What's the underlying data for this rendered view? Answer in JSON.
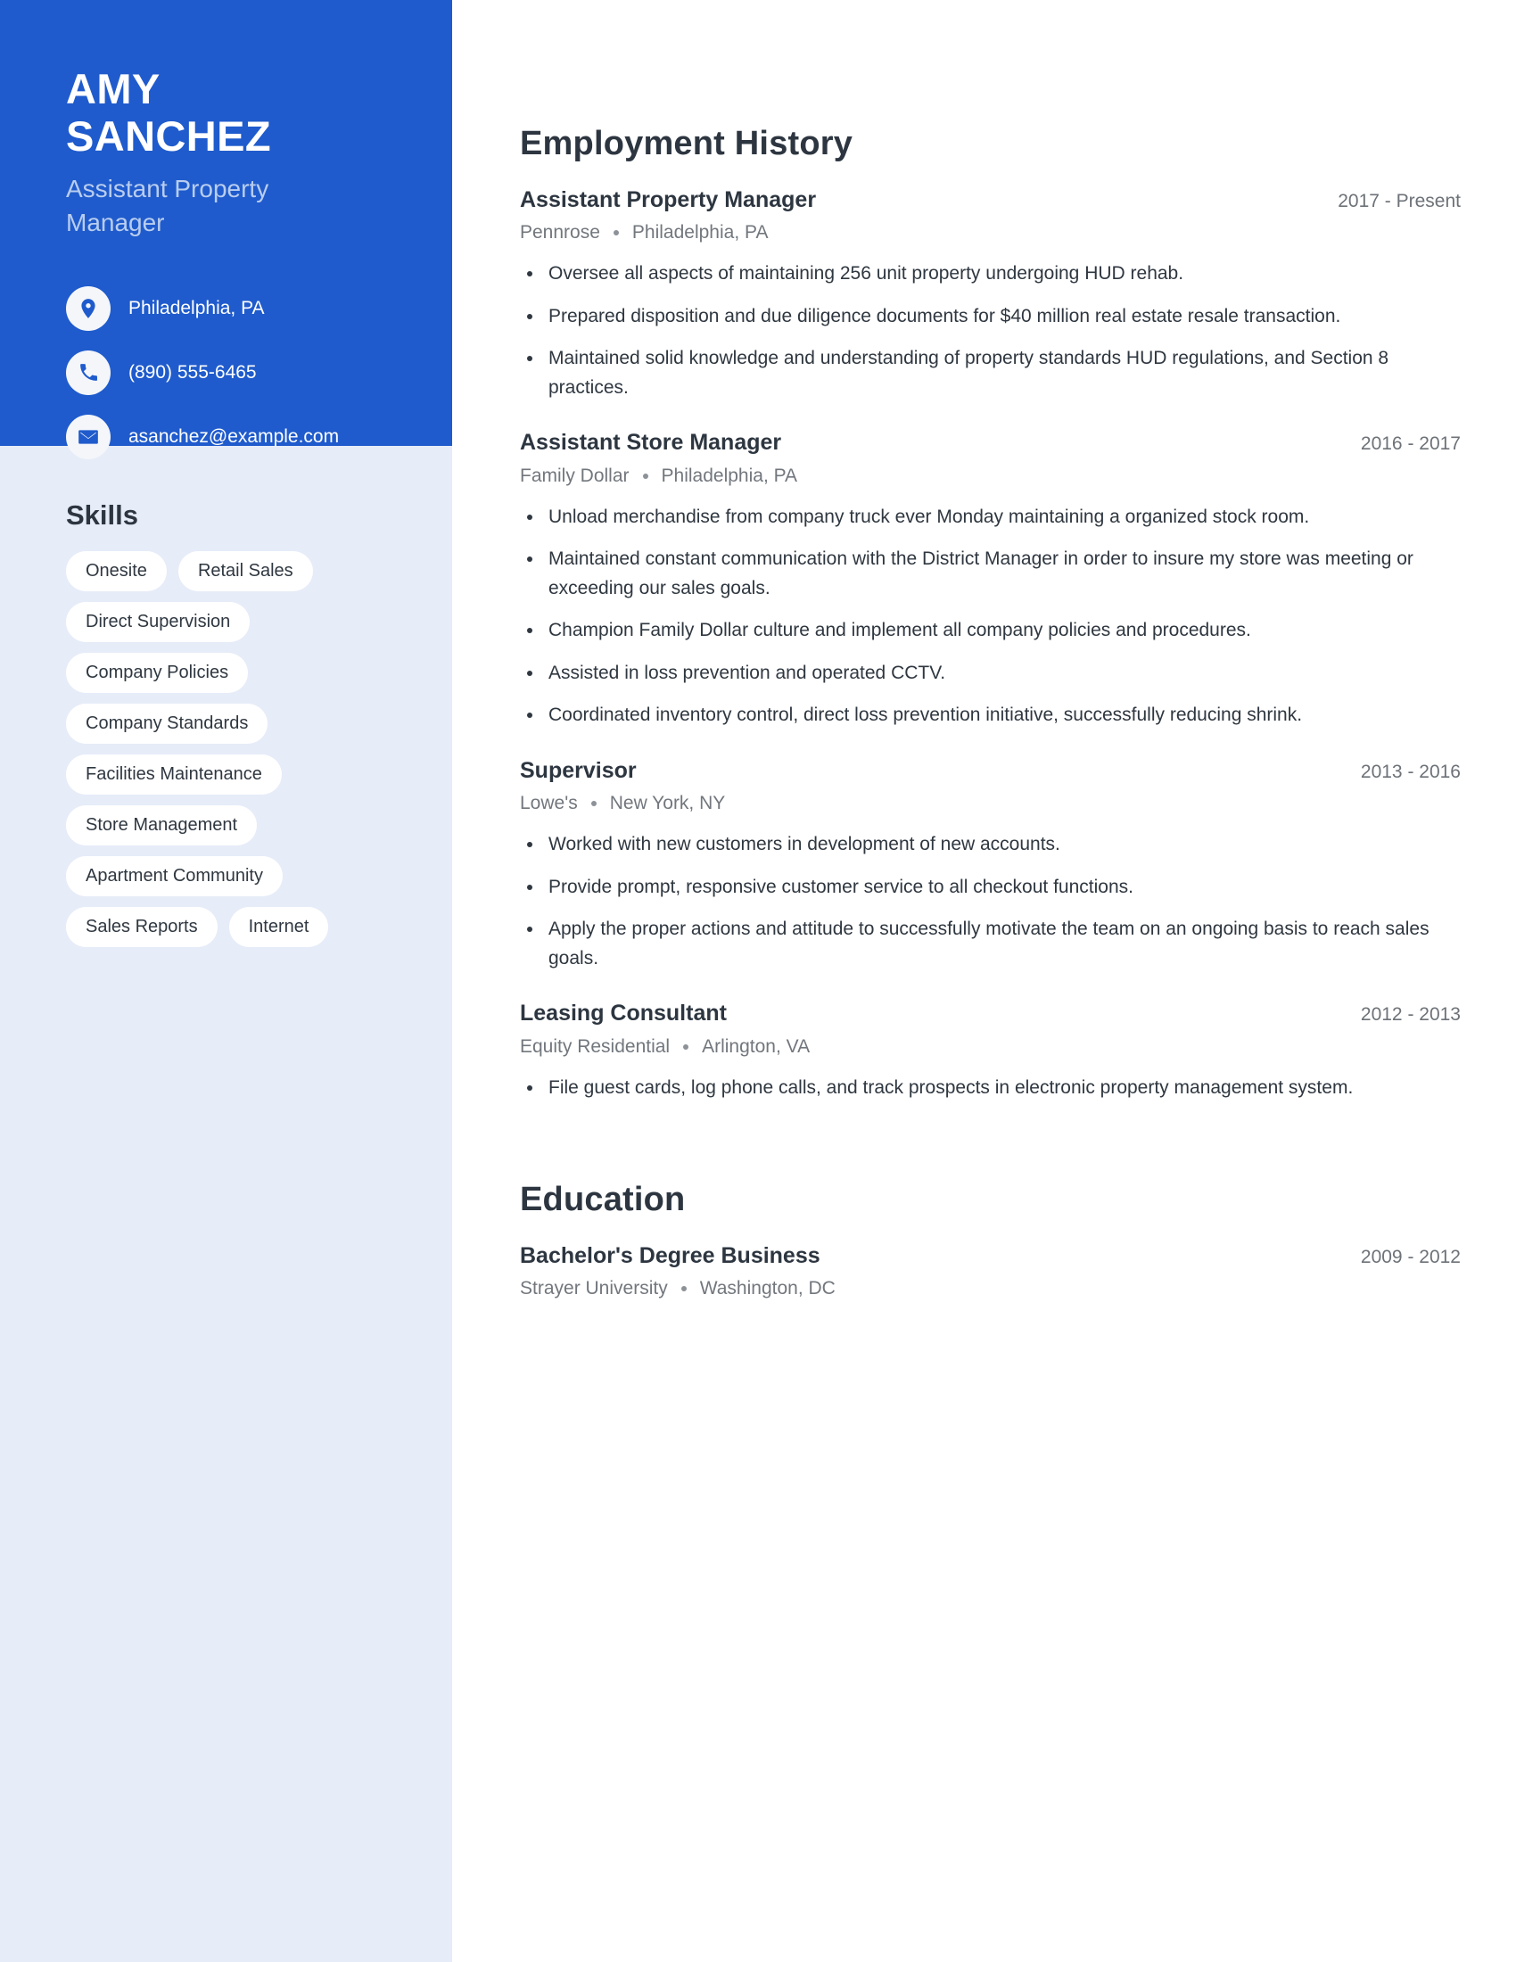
{
  "theme": {
    "accent_blue": "#1f5bcc",
    "sidebar_light": "#e6ecf8",
    "text_dark": "#2d3640",
    "text_muted": "#72777d",
    "subtitle_blue": "#b9cdef"
  },
  "profile": {
    "first_name": "AMY",
    "last_name": "SANCHEZ",
    "job_title": "Assistant Property Manager"
  },
  "contact": {
    "items": [
      {
        "icon": "location-pin-icon",
        "name": "location",
        "value": "Philadelphia, PA"
      },
      {
        "icon": "phone-icon",
        "name": "phone",
        "value": "(890) 555-6465"
      },
      {
        "icon": "envelope-icon",
        "name": "email",
        "value": "asanchez@example.com"
      }
    ]
  },
  "skills": {
    "title": "Skills",
    "tags": [
      "Onesite",
      "Retail Sales",
      "Direct Supervision",
      "Company Policies",
      "Company Standards",
      "Facilities Maintenance",
      "Store Management",
      "Apartment Community",
      "Sales Reports",
      "Internet"
    ]
  },
  "employment": {
    "title": "Employment History",
    "entries": [
      {
        "role": "Assistant Property Manager",
        "dates": "2017 - Present",
        "company": "Pennrose",
        "location": "Philadelphia, PA",
        "bullets": [
          "Oversee all aspects of maintaining 256 unit property undergoing HUD rehab.",
          "Prepared disposition and due diligence documents for $40 million real estate resale transaction.",
          "Maintained solid knowledge and understanding of property standards HUD regulations, and Section 8 practices."
        ]
      },
      {
        "role": "Assistant Store Manager",
        "dates": "2016 - 2017",
        "company": "Family Dollar",
        "location": "Philadelphia, PA",
        "bullets": [
          "Unload merchandise from company truck ever Monday maintaining a organized stock room.",
          "Maintained constant communication with the District Manager in order to insure my store was meeting or exceeding our sales goals.",
          "Champion Family Dollar culture and implement all company policies and procedures.",
          "Assisted in loss prevention and operated CCTV.",
          "Coordinated inventory control, direct loss prevention initiative, successfully reducing shrink."
        ]
      },
      {
        "role": "Supervisor",
        "dates": "2013 - 2016",
        "company": "Lowe's",
        "location": "New York, NY",
        "bullets": [
          "Worked with new customers in development of new accounts.",
          "Provide prompt, responsive customer service to all checkout functions.",
          "Apply the proper actions and attitude to successfully motivate the team on an ongoing basis to reach sales goals."
        ]
      },
      {
        "role": "Leasing Consultant",
        "dates": "2012 - 2013",
        "company": "Equity Residential",
        "location": "Arlington, VA",
        "bullets": [
          "File guest cards, log phone calls, and track prospects in electronic property management system."
        ]
      }
    ]
  },
  "education": {
    "title": "Education",
    "entries": [
      {
        "role": "Bachelor's Degree Business",
        "dates": "2009 - 2012",
        "company": "Strayer University",
        "location": "Washington, DC",
        "bullets": []
      }
    ]
  }
}
